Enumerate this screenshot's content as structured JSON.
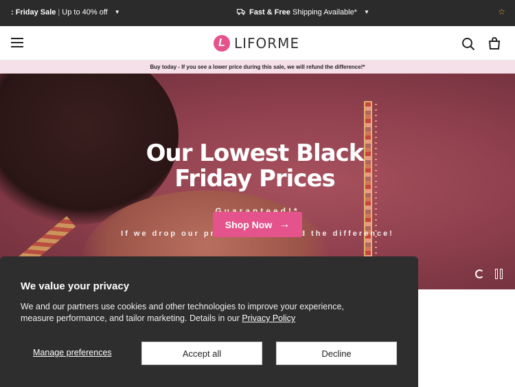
{
  "topbar": {
    "promo_bold": ": Friday Sale",
    "promo_sep": "|",
    "promo_rest": "Up to 40% off",
    "shipping_bold": "Fast & Free",
    "shipping_rest": "Shipping Available*",
    "colors": {
      "background": "#2b2b2b",
      "star": "#f0a13c"
    }
  },
  "header": {
    "logo_mark": "L",
    "logo_text": "LIFORME",
    "icons": [
      "menu-icon",
      "search-icon",
      "bag-icon"
    ],
    "brand_color": "#e4538c"
  },
  "notice": {
    "text": "Buy today - If you see a lower price during this sale, we will refund the difference!*"
  },
  "hero": {
    "title_line1": "Our Lowest Black",
    "title_line2": "Friday Prices",
    "subtitle": "Guaranteed!*",
    "subtext": "If we drop our price, we'll refund the difference!",
    "cta_label": "Shop Now",
    "cta_arrow": "→"
  },
  "cookie_banner": {
    "title": "We value your privacy",
    "body": "We and our partners use cookies and other technologies to improve your experience, measure performance, and tailor marketing. Details in our",
    "policy_link": "Privacy Policy",
    "manage_label": "Manage preferences",
    "accept_label": "Accept all",
    "decline_label": "Decline"
  }
}
